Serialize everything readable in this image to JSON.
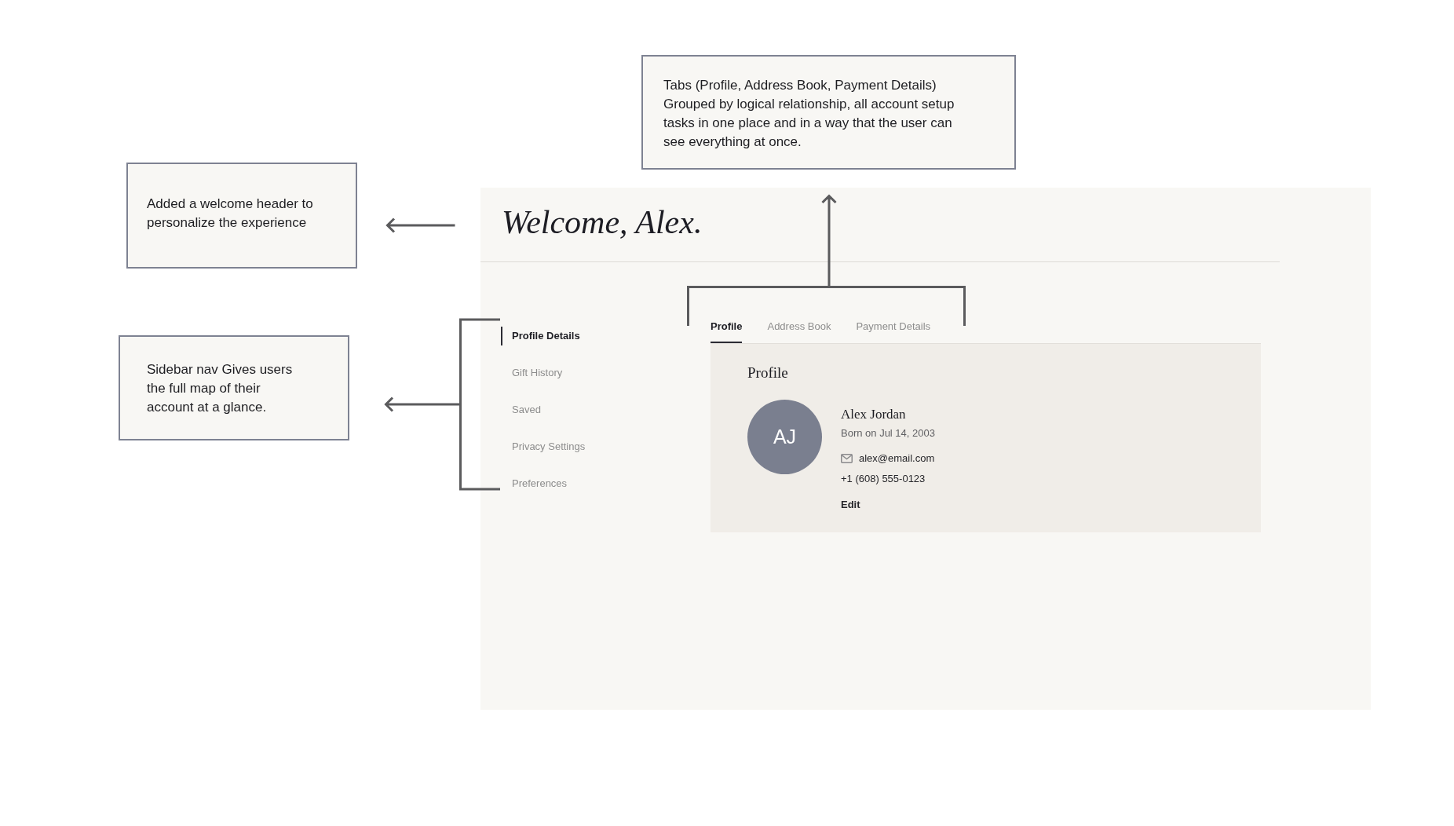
{
  "annotations": [
    {
      "text": "Tabs (Profile, Address Book, Payment Details)\nGrouped by logical relationship, all account setup tasks in one place and in a way that the user can see everything at once."
    },
    {
      "text": "Added a welcome header to personalize the experience"
    },
    {
      "text": "Sidebar nav Gives users the full map of their account at a glance."
    }
  ],
  "page": {
    "title": "Welcome, Alex.",
    "sidebar": {
      "items": [
        {
          "label": "Profile Details",
          "selected": true
        },
        {
          "label": "Gift History",
          "selected": false
        },
        {
          "label": "Saved",
          "selected": false
        },
        {
          "label": "Privacy Settings",
          "selected": false
        },
        {
          "label": "Preferences",
          "selected": false
        }
      ]
    },
    "tabs": [
      {
        "label": "Profile",
        "selected": true
      },
      {
        "label": "Address Book",
        "selected": false
      },
      {
        "label": "Payment Details",
        "selected": false
      }
    ],
    "profile": {
      "heading": "Profile",
      "initials": "AJ",
      "name": "Alex Jordan",
      "born": "Born on Jul 14, 2003",
      "email": "alex@email.com",
      "phone": "+1 (608) 555-0123",
      "edit_label": "Edit"
    }
  }
}
